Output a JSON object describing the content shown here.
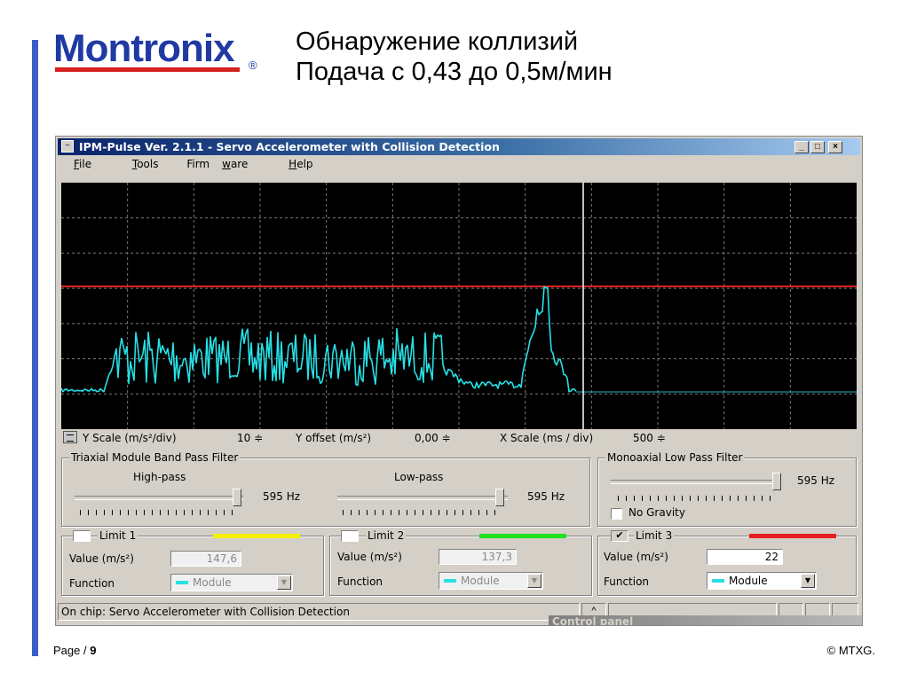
{
  "slide": {
    "logo": "Montronix",
    "logo_reg": "®",
    "title_line1": "Обнаружение коллизий",
    "title_line2": "Подача с 0,43 до 0,5м/мин",
    "footer_page_label": "Page / ",
    "footer_page_num": "9",
    "footer_copyright": "© MTXG."
  },
  "window": {
    "title": "IPM-Pulse Ver. 2.1.1 - Servo Accelerometer with Collision Detection",
    "controls": {
      "minimize": "_",
      "maximize": "□",
      "close": "×"
    },
    "menu": [
      {
        "pre": "",
        "ul": "F",
        "post": "ile"
      },
      {
        "pre": "",
        "ul": "T",
        "post": "ools"
      },
      {
        "pre": "Firm",
        "ul": "w",
        "post": "are"
      },
      {
        "pre": "",
        "ul": "H",
        "post": "elp"
      }
    ]
  },
  "scope": {
    "background": "#000000",
    "trace_color": "#26e0e6",
    "limit_line_color": "#e02020",
    "baseline_color": "#26b5b8",
    "cursor_color": "#ffffff"
  },
  "scalebar": {
    "y_scale_label": "Y Scale (m/s²/div)",
    "y_scale_value": "10 ≑",
    "y_offset_label": "Y offset (m/s²)",
    "y_offset_value": "0,00 ≑",
    "x_scale_label": "X Scale (ms / div)",
    "x_scale_value": "500 ≑"
  },
  "triaxial": {
    "title": "Triaxial Module Band Pass Filter",
    "highpass_label": "High-pass",
    "highpass_value": "595 Hz",
    "lowpass_label": "Low-pass",
    "lowpass_value": "595 Hz"
  },
  "monoaxial": {
    "title": "Monoaxial Low Pass Filter",
    "value": "595 Hz",
    "no_gravity_label": "No Gravity"
  },
  "limits": [
    {
      "title": "Limit 1",
      "checked": "",
      "color": "#f5f000",
      "value_label": "Value (m/s²)",
      "value": "147,6",
      "function_label": "Function",
      "function_value": "Module"
    },
    {
      "title": "Limit 2",
      "checked": "",
      "color": "#20e020",
      "value_label": "Value (m/s²)",
      "value": "137,3",
      "function_label": "Function",
      "function_value": "Module"
    },
    {
      "title": "Limit 3",
      "checked": "✔",
      "color": "#e62020",
      "value_label": "Value (m/s²)",
      "value": "22",
      "function_label": "Function",
      "function_value": "Module"
    }
  ],
  "dropdown_arrow": "▼",
  "statusbar": {
    "text": "On chip: Servo Accelerometer with Collision Detection",
    "caret": "^"
  },
  "control_panel_label": "Control panel"
}
